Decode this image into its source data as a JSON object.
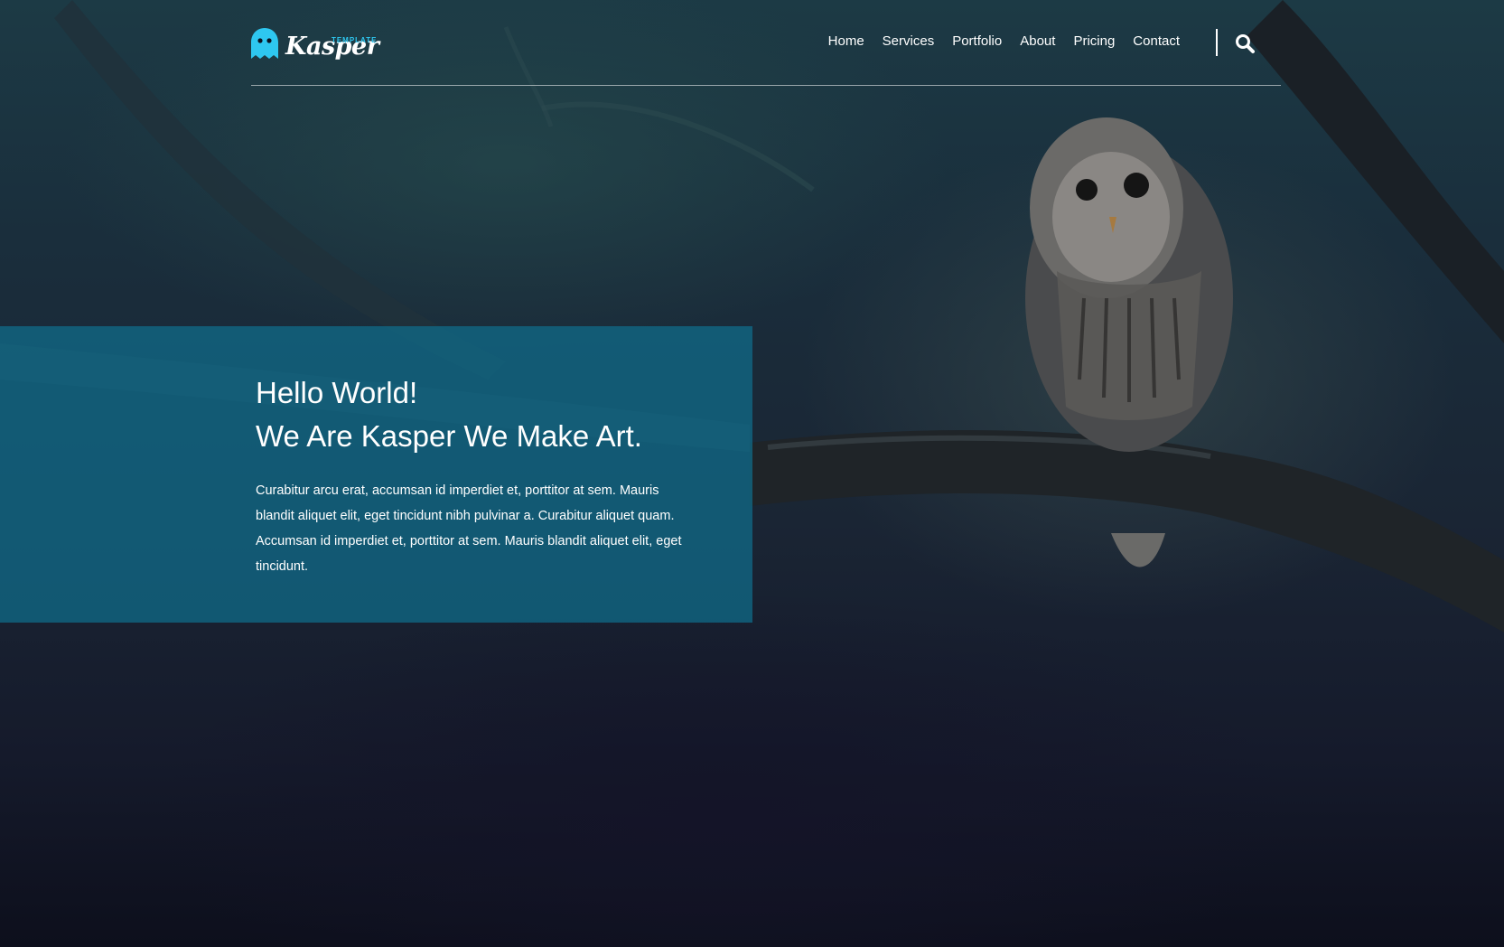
{
  "brand": {
    "name": "Kasper",
    "tagline": "TEMPLATE",
    "accent": "#2ec7f0"
  },
  "nav": {
    "items": [
      {
        "label": "Home"
      },
      {
        "label": "Services"
      },
      {
        "label": "Portfolio"
      },
      {
        "label": "About"
      },
      {
        "label": "Pricing"
      },
      {
        "label": "Contact"
      }
    ],
    "search_icon": "search-icon"
  },
  "hero": {
    "greeting": "Hello World!",
    "headline": "We Are Kasper We Make Art.",
    "body": "Curabitur arcu erat, accumsan id imperdiet et, porttitor at sem. Mauris blandit aliquet elit, eget tincidunt nibh pulvinar a. Curabitur aliquet quam. Accumsan id imperdiet et, porttitor at sem. Mauris blandit aliquet elit, eget tincidunt.",
    "box_color": "#0f6e8c"
  }
}
